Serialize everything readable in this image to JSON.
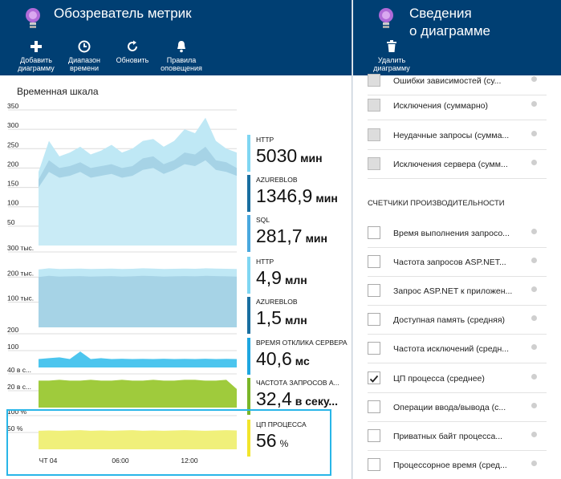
{
  "metrics_blade": {
    "title": "Обозреватель метрик",
    "toolbar": [
      {
        "label": "Добавить\nдиаграмму",
        "icon": "plus-icon"
      },
      {
        "label": "Диапазон\nвремени",
        "icon": "clock-icon"
      },
      {
        "label": "Обновить",
        "icon": "refresh-icon"
      },
      {
        "label": "Правила\nоповещения",
        "icon": "bell-icon"
      }
    ],
    "timeline_title": "Временная шкала"
  },
  "chart_data": [
    {
      "type": "area",
      "title": "",
      "y_ticks": [
        "350",
        "300",
        "250",
        "200",
        "150",
        "100",
        "50"
      ],
      "ylim": [
        0,
        350
      ],
      "series": [
        {
          "name": "HTTP",
          "color": "#bfe8f5",
          "values": [
            190,
            270,
            230,
            240,
            255,
            235,
            245,
            260,
            240,
            250,
            270,
            275,
            255,
            270,
            300,
            290,
            330,
            270,
            250,
            240
          ]
        },
        {
          "name": "AZUREBLOB",
          "color": "#a6d3e6",
          "values": [
            170,
            220,
            200,
            205,
            215,
            200,
            205,
            210,
            200,
            205,
            225,
            230,
            210,
            220,
            240,
            235,
            255,
            220,
            215,
            200
          ]
        },
        {
          "name": "SQL",
          "color": "#c9ebf6",
          "values": [
            150,
            190,
            175,
            180,
            190,
            175,
            180,
            185,
            175,
            180,
            195,
            200,
            185,
            195,
            210,
            205,
            220,
            195,
            190,
            180
          ]
        }
      ],
      "legend": [
        {
          "name": "HTTP",
          "value": "5030",
          "unit": "мин",
          "color": "#7fd6f2"
        },
        {
          "name": "AZUREBLOB",
          "value": "1346,9",
          "unit": "мин",
          "color": "#1a6fa0"
        },
        {
          "name": "SQL",
          "value": "281,7",
          "unit": "мин",
          "color": "#4aa8de"
        }
      ]
    },
    {
      "type": "area",
      "title": "",
      "y_ticks": [
        "300 тыс.",
        "200 тыс.",
        "100 тыс."
      ],
      "ylim": [
        0,
        300000
      ],
      "series": [
        {
          "name": "HTTP",
          "color": "#bfe8f5",
          "values": [
            230000,
            235000,
            232000,
            233000,
            234000,
            232000,
            233000,
            234000,
            232000,
            233000,
            235000,
            234000,
            232000,
            233000,
            234000,
            233000,
            235000,
            234000,
            233000,
            232000
          ]
        },
        {
          "name": "AZUREBLOB",
          "color": "#a6d3e6",
          "values": [
            200000,
            205000,
            202000,
            203000,
            204000,
            202000,
            203000,
            204000,
            202000,
            203000,
            205000,
            204000,
            202000,
            203000,
            204000,
            203000,
            205000,
            204000,
            203000,
            202000
          ]
        }
      ],
      "legend": [
        {
          "name": "HTTP",
          "value": "4,9",
          "unit": "млн",
          "color": "#7fd6f2"
        },
        {
          "name": "AZUREBLOB",
          "value": "1,5",
          "unit": "млн",
          "color": "#1a6fa0"
        }
      ]
    },
    {
      "type": "area",
      "title": "",
      "y_ticks": [
        "200",
        "100"
      ],
      "ylim": [
        0,
        200
      ],
      "series": [
        {
          "name": "ВРЕМЯ ОТКЛИКА СЕРВЕРА",
          "color": "#4cc5ee",
          "values": [
            50,
            55,
            60,
            50,
            95,
            50,
            55,
            50,
            52,
            50,
            51,
            50,
            52,
            50,
            51,
            50,
            52,
            50,
            51,
            50
          ]
        }
      ],
      "legend": [
        {
          "name": "ВРЕМЯ ОТКЛИКА СЕРВЕРА",
          "value": "40,6",
          "unit": "мс",
          "color": "#1ea6e0"
        }
      ]
    },
    {
      "type": "area",
      "title": "",
      "y_ticks": [
        "40 в с...",
        "20 в с..."
      ],
      "ylim": [
        0,
        40
      ],
      "series": [
        {
          "name": "ЧАСТОТА ЗАПРОСОВ A...",
          "color": "#9fcb3c",
          "values": [
            32,
            32,
            33,
            32,
            32,
            33,
            32,
            32,
            33,
            32,
            32,
            33,
            32,
            32,
            33,
            33,
            32,
            32,
            33,
            22
          ]
        }
      ],
      "legend": [
        {
          "name": "ЧАСТОТА ЗАПРОСОВ A...",
          "value": "32,4",
          "unit": "в секу...",
          "color": "#7ab629"
        }
      ]
    },
    {
      "type": "area",
      "title": "",
      "y_ticks": [
        "100 %",
        "50 %"
      ],
      "ylim": [
        0,
        100
      ],
      "x_ticks": [
        "ЧТ 04",
        "06:00",
        "12:00"
      ],
      "series": [
        {
          "name": "ЦП ПРОЦЕССА",
          "color": "#f0f07a",
          "values": [
            55,
            56,
            55,
            56,
            57,
            55,
            56,
            55,
            56,
            57,
            55,
            56,
            55,
            56,
            57,
            56,
            55,
            56,
            57,
            56
          ]
        }
      ],
      "legend": [
        {
          "name": "ЦП ПРОЦЕССА",
          "value": "56",
          "unit": "%",
          "color": "#f2e52c"
        }
      ]
    }
  ],
  "details_blade": {
    "title_line1": "Сведения",
    "title_line2": "о диаграмме",
    "delete_label": "Удалить\nдиаграмму",
    "section_title": "СЧЕТЧИКИ ПРОИЗВОДИТЕЛЬНОСТИ",
    "top_items": [
      {
        "label": "Ошибки зависимостей (су...",
        "checked": false
      },
      {
        "label": "Исключения (суммарно)",
        "checked": false
      },
      {
        "label": "Неудачные запросы (сумма...",
        "checked": false
      },
      {
        "label": "Исключения сервера (сумм...",
        "checked": false
      }
    ],
    "perf_items": [
      {
        "label": "Время выполнения запросо...",
        "checked": false
      },
      {
        "label": "Частота запросов ASP.NET...",
        "checked": false
      },
      {
        "label": "Запрос ASP.NET к приложен...",
        "checked": false
      },
      {
        "label": "Доступная память (средняя)",
        "checked": false
      },
      {
        "label": "Частота исключений (средн...",
        "checked": false
      },
      {
        "label": "ЦП процесса (среднее)",
        "checked": true
      },
      {
        "label": "Операции ввода/вывода (с...",
        "checked": false
      },
      {
        "label": "Приватных байт процесса...",
        "checked": false
      },
      {
        "label": "Процессорное время (сред...",
        "checked": false
      }
    ]
  }
}
